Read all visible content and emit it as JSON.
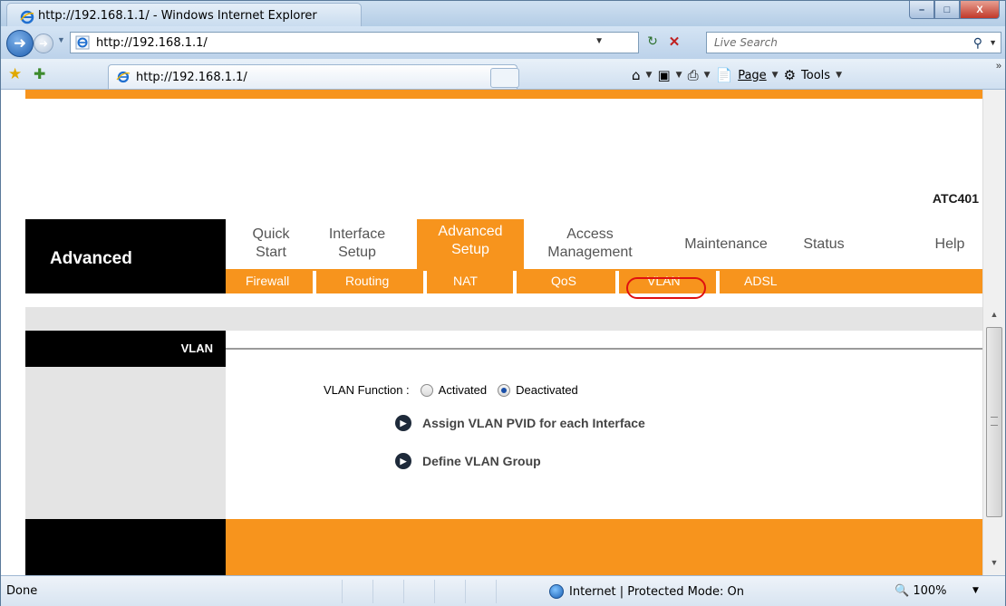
{
  "window": {
    "title": "http://192.168.1.1/ - Windows Internet Explorer",
    "controls": {
      "minimize": "–",
      "maximize": "□",
      "close": "X"
    }
  },
  "address_bar": {
    "url": "http://192.168.1.1/",
    "search_placeholder": "Live Search"
  },
  "command_bar": {
    "tab_title": "http://192.168.1.1/",
    "page_label": "Page",
    "tools_label": "Tools"
  },
  "router_page": {
    "model": "ATC401",
    "section_label": "Advanced",
    "main_menu": [
      {
        "line1": "Quick",
        "line2": "Start"
      },
      {
        "line1": "Interface",
        "line2": "Setup"
      },
      {
        "line1": "Advanced",
        "line2": "Setup",
        "active": true
      },
      {
        "line1": "Access",
        "line2": "Management"
      },
      {
        "line1": "Maintenance"
      },
      {
        "line1": "Status"
      },
      {
        "line1": "Help"
      }
    ],
    "sub_menu": [
      "Firewall",
      "Routing",
      "NAT",
      "QoS",
      "VLAN",
      "ADSL"
    ],
    "sub_menu_highlighted": "VLAN",
    "section_title": "VLAN",
    "vlan_function": {
      "label": "VLAN Function :",
      "options": [
        "Activated",
        "Deactivated"
      ],
      "selected": "Deactivated"
    },
    "links": [
      "Assign VLAN PVID for each Interface",
      "Define VLAN Group"
    ],
    "colors": {
      "accent": "#f7941d",
      "dark": "#000000",
      "panel": "#e4e4e4"
    }
  },
  "status_bar": {
    "status": "Done",
    "zone": "Internet | Protected Mode: On",
    "zoom": "100%"
  }
}
